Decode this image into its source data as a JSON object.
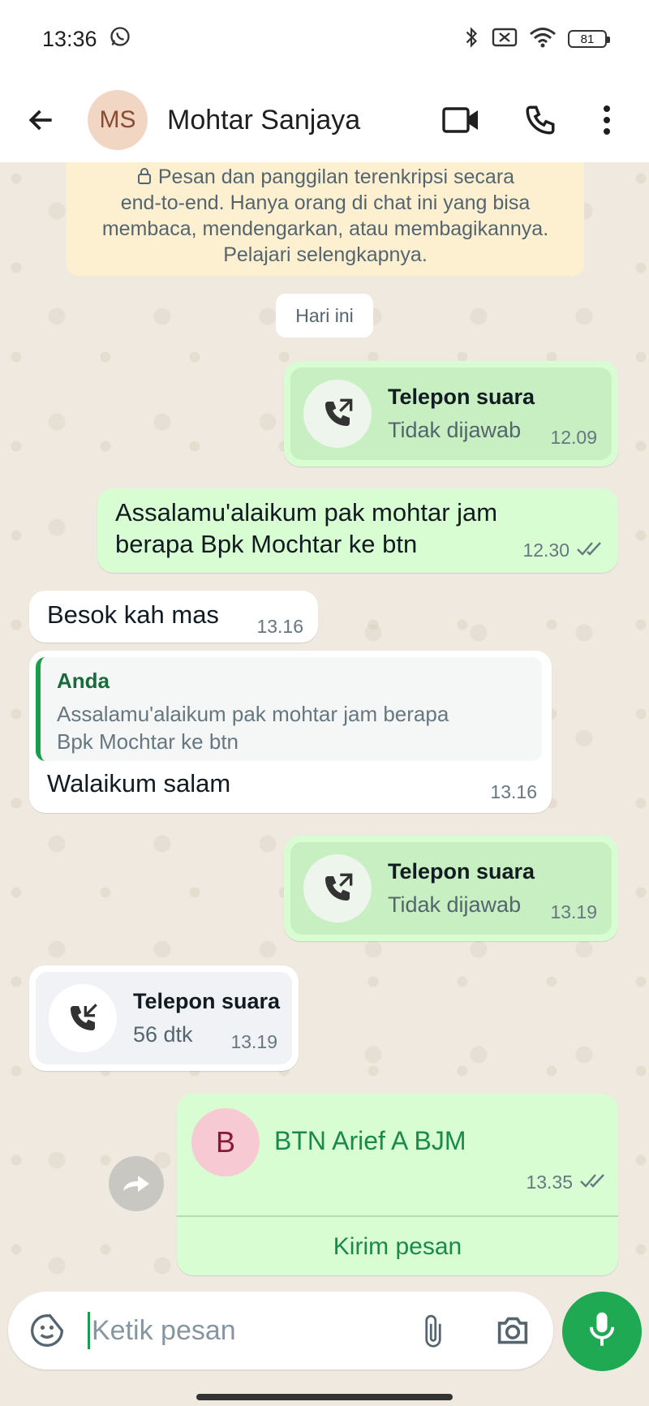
{
  "status_bar": {
    "time": "13:36",
    "battery": "81",
    "icons": [
      "whatsapp-icon",
      "bluetooth-icon",
      "mute-icon",
      "wifi-icon",
      "battery-icon"
    ]
  },
  "header": {
    "avatar_initials": "MS",
    "contact_name": "Mohtar Sanjaya",
    "icons": [
      "back-arrow-icon",
      "video-call-icon",
      "phone-icon",
      "more-vert-icon"
    ]
  },
  "encryption_notice": {
    "line1": "Pesan dan panggilan terenkripsi secara",
    "line2": "end-to-end. Hanya orang di chat ini yang bisa",
    "line3": "membaca, mendengarkan, atau membagikannya.",
    "line4": "Pelajari selengkapnya."
  },
  "date_divider": "Hari ini",
  "messages": {
    "call1": {
      "title": "Telepon suara",
      "status": "Tidak dijawab",
      "time": "12.09"
    },
    "text1": {
      "line1": "Assalamu'alaikum pak mohtar jam",
      "line2": "berapa Bpk Mochtar ke btn",
      "time": "12.30"
    },
    "text2": {
      "text": "Besok kah mas",
      "time": "13.16"
    },
    "reply1": {
      "quote_author": "Anda",
      "quote_line1": "Assalamu'alaikum pak mohtar jam berapa",
      "quote_line2": "Bpk Mochtar ke btn",
      "text": "Walaikum salam",
      "time": "13.16"
    },
    "call2": {
      "title": "Telepon suara",
      "status": "Tidak dijawab",
      "time": "13.19"
    },
    "call3": {
      "title": "Telepon suara",
      "status": "56 dtk",
      "time": "13.19"
    },
    "contact_card": {
      "initial": "B",
      "name": "BTN Arief A BJM",
      "time": "13.35",
      "action": "Kirim pesan"
    }
  },
  "composer": {
    "placeholder": "Ketik pesan",
    "icons": [
      "sticker-icon",
      "attach-icon",
      "camera-icon",
      "mic-icon"
    ]
  },
  "colors": {
    "outgoing_bubble": "#d9fdd3",
    "incoming_bubble": "#ffffff",
    "accent_green": "#1ea952",
    "read_ticks": "#667781"
  }
}
